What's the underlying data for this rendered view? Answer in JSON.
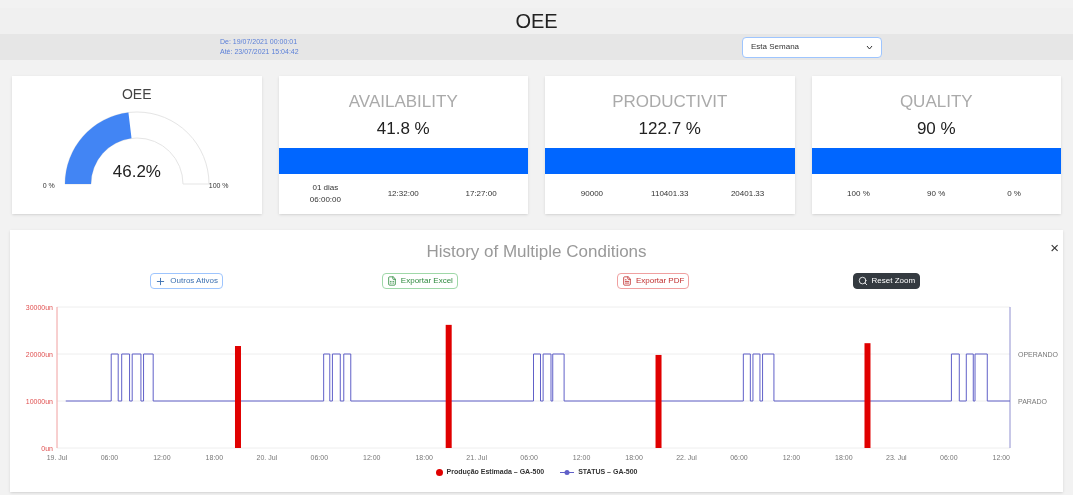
{
  "title": "OEE",
  "date_range": {
    "from": "De: 19/07/2021 00:00:01",
    "to": "Até: 23/07/2021 15:04:42"
  },
  "period_select": {
    "value": "Esta Semana"
  },
  "gauge": {
    "title": "OEE",
    "reading": "46.2%",
    "min_label": "0 %",
    "max_label": "100 %"
  },
  "metrics": [
    {
      "title": "AVAILABILITY",
      "value": "41.8 %",
      "stats": [
        "01 dias 06:00:00",
        "12:32:00",
        "17:27:00"
      ]
    },
    {
      "title": "PRODUCTIVIT",
      "value": "122.7 %",
      "stats": [
        "90000",
        "110401.33",
        "20401.33"
      ]
    },
    {
      "title": "QUALITY",
      "value": "90 %",
      "stats": [
        "100 %",
        "90 %",
        "0 %"
      ]
    }
  ],
  "history": {
    "title": "History of Multiple Conditions",
    "close": "×",
    "buttons": [
      {
        "kind": "add",
        "label": "Outros Ativos"
      },
      {
        "kind": "excel",
        "label": "Exportar Excel"
      },
      {
        "kind": "pdf",
        "label": "Exportar PDF"
      },
      {
        "kind": "zoom",
        "label": "Reset Zoom"
      }
    ],
    "right_axis_labels": [
      "OPERANDO",
      "PARADO"
    ],
    "x_time_labels": [
      "06:00",
      "12:00",
      "18:00",
      "06:00",
      "12:00",
      "18:00",
      "06:00",
      "12:00",
      "18:00",
      "06:00",
      "12:00"
    ],
    "chart_data": {
      "type": "bar",
      "xlim": [
        0,
        109
      ],
      "ylim": [
        0,
        30000
      ],
      "xticks": [
        {
          "value": 0,
          "label": "19. Jul"
        },
        {
          "value": 6,
          "label": "06:00"
        },
        {
          "value": 12,
          "label": "12:00"
        },
        {
          "value": 18,
          "label": "18:00"
        },
        {
          "value": 24,
          "label": "20. Jul"
        },
        {
          "value": 48,
          "label": "21. Jul"
        },
        {
          "value": 72,
          "label": "22. Jul"
        },
        {
          "value": 96,
          "label": "23. Jul"
        }
      ],
      "yticks": [
        {
          "value": 0,
          "label": "0un"
        },
        {
          "value": 10000,
          "label": "10000un"
        },
        {
          "value": 20000,
          "label": "20000un"
        },
        {
          "value": 30000,
          "label": "30000un"
        }
      ],
      "x": [
        20.7,
        44.8,
        68.8,
        92.7
      ],
      "series": [
        {
          "name": "Produção Estimada – GA-500",
          "color": "#e00000",
          "values": [
            21700,
            26200,
            19800,
            22300
          ]
        },
        {
          "name": "STATUS – GA-500",
          "color": "#6060c8",
          "type": "line",
          "x": [
            1,
            6.2,
            6.2,
            7,
            7,
            7.4,
            7.4,
            8.3,
            8.3,
            8.6,
            8.6,
            9.6,
            9.6,
            9.9,
            9.9,
            11,
            11,
            30.5,
            30.5,
            31.2,
            31.2,
            31.5,
            31.5,
            32.4,
            32.4,
            32.8,
            32.8,
            33.6,
            33.6,
            54.5,
            54.5,
            55.3,
            55.3,
            55.6,
            55.6,
            56.5,
            56.5,
            56.7,
            56.7,
            58,
            58,
            78.5,
            78.5,
            79.3,
            79.3,
            79.6,
            79.6,
            80.4,
            80.4,
            80.7,
            80.7,
            82,
            82,
            102.3,
            102.3,
            103.2,
            103.2,
            104,
            104,
            104.8,
            104.8,
            105,
            105,
            106.4,
            106.4,
            109
          ],
          "values": [
            10000,
            10000,
            20000,
            20000,
            10000,
            10000,
            20000,
            20000,
            10000,
            10000,
            20000,
            20000,
            10000,
            10000,
            20000,
            20000,
            10000,
            10000,
            20000,
            20000,
            10000,
            10000,
            20000,
            20000,
            10000,
            10000,
            20000,
            20000,
            10000,
            10000,
            20000,
            20000,
            10000,
            10000,
            20000,
            20000,
            10000,
            10000,
            20000,
            20000,
            10000,
            10000,
            20000,
            20000,
            10000,
            10000,
            20000,
            20000,
            10000,
            10000,
            20000,
            20000,
            10000,
            10000,
            20000,
            20000,
            10000,
            10000,
            20000,
            20000,
            10000,
            10000,
            20000,
            20000,
            10000,
            10000
          ]
        }
      ]
    }
  }
}
